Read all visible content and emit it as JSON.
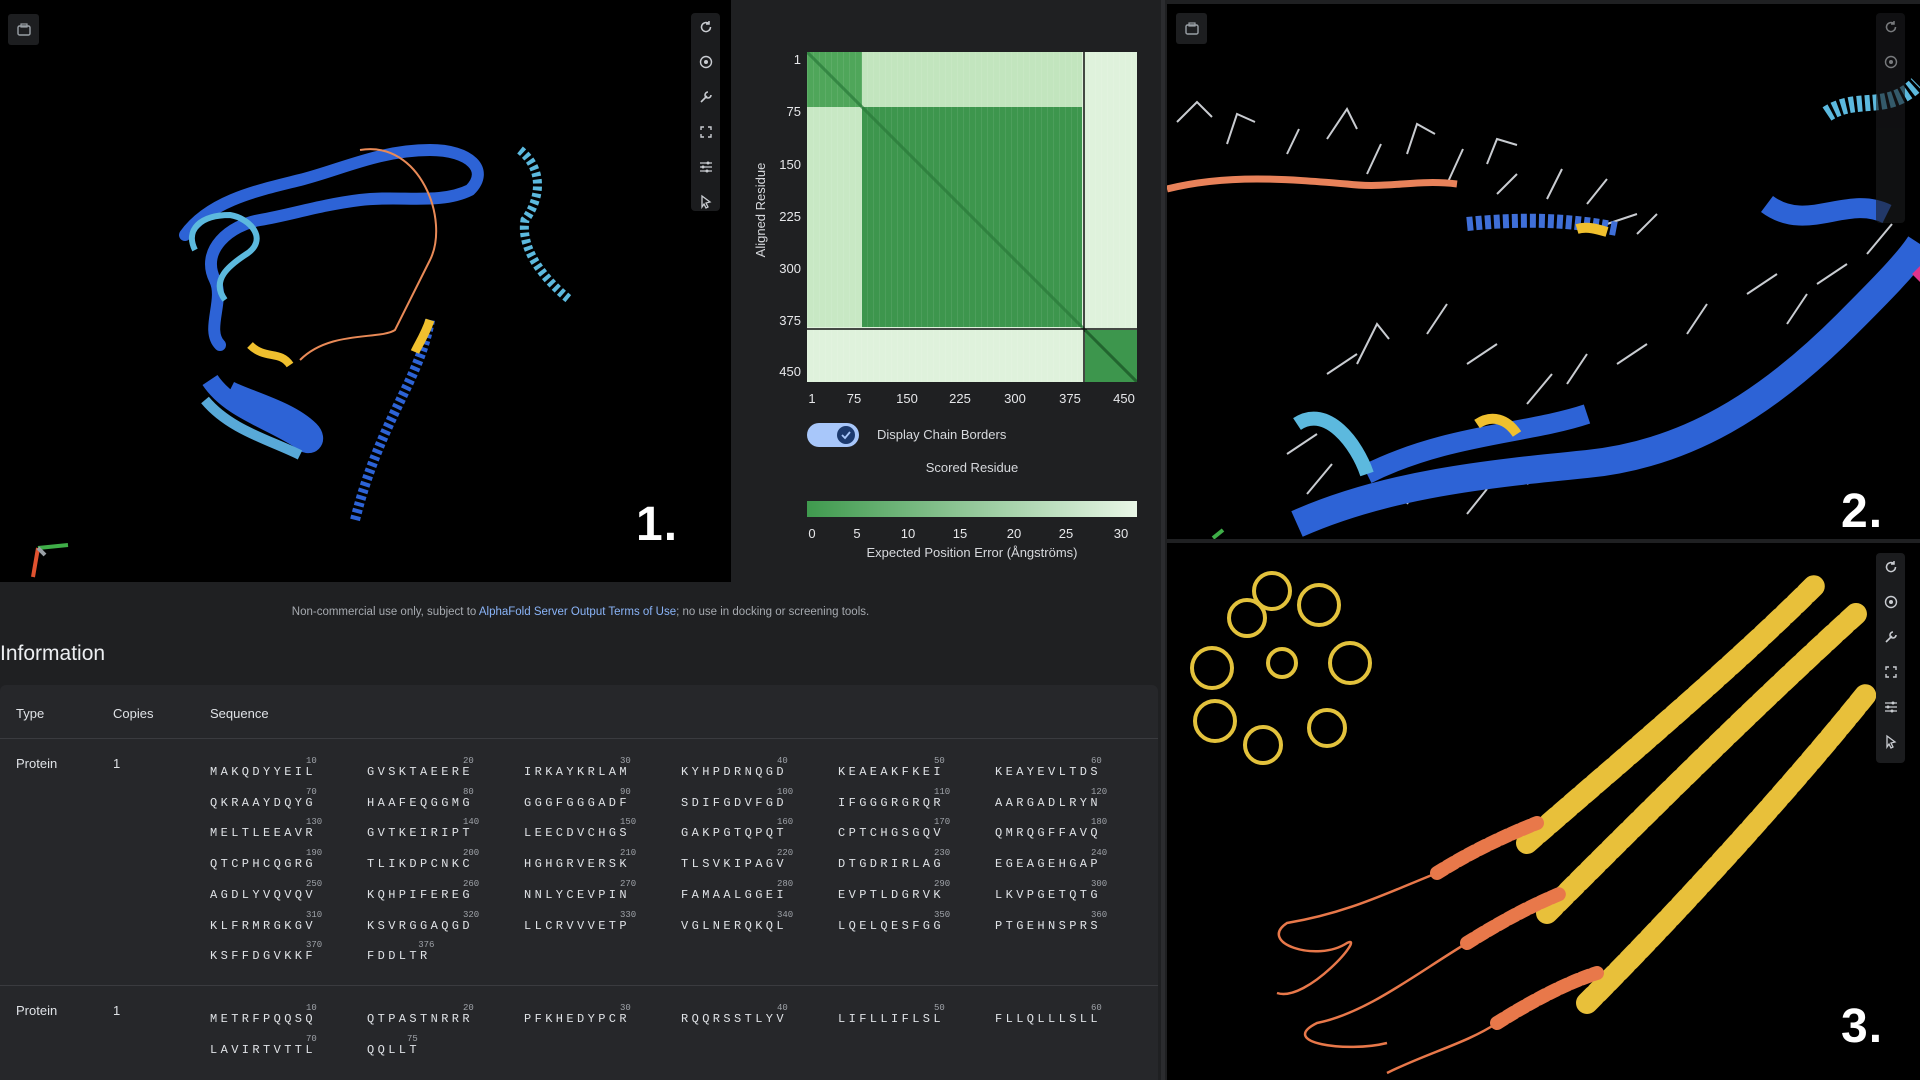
{
  "panel_labels": {
    "p1": "1.",
    "p2": "2.",
    "p3": "3."
  },
  "pae": {
    "y_axis_title": "Aligned Residue",
    "x_axis_title": "Scored Residue",
    "y_ticks": [
      "1",
      "75",
      "150",
      "225",
      "300",
      "375",
      "450"
    ],
    "x_ticks": [
      "1",
      "75",
      "150",
      "225",
      "300",
      "375",
      "450"
    ],
    "toggle_label": "Display Chain Borders",
    "toggle_on": true,
    "legend_ticks": [
      "0",
      "5",
      "10",
      "15",
      "20",
      "25",
      "30"
    ],
    "legend_title": "Expected Position Error (Ångströms)",
    "colors": {
      "dark": "#2e8b46",
      "light": "#e8f6e6"
    }
  },
  "footer": {
    "prefix": "Non-commercial use only, subject to ",
    "link": "AlphaFold Server Output Terms of Use",
    "suffix": "; no use in docking or screening tools."
  },
  "info": {
    "heading": "Information",
    "columns": {
      "type": "Type",
      "copies": "Copies",
      "sequence": "Sequence"
    },
    "rows": [
      {
        "type": "Protein",
        "copies": "1",
        "chunks": [
          {
            "idx": "10",
            "seq": "MAKQDYYEIL"
          },
          {
            "idx": "20",
            "seq": "GVSKTAEERE"
          },
          {
            "idx": "30",
            "seq": "IRKAYKRLAM"
          },
          {
            "idx": "40",
            "seq": "KYHPDRNQGD"
          },
          {
            "idx": "50",
            "seq": "KEAEAKFKEI"
          },
          {
            "idx": "60",
            "seq": "KEAYEVLTDS"
          },
          {
            "idx": "70",
            "seq": "QKRAAYDQYG"
          },
          {
            "idx": "80",
            "seq": "HAAFEQGGMG"
          },
          {
            "idx": "90",
            "seq": "GGGFGGGADF"
          },
          {
            "idx": "100",
            "seq": "SDIFGDVFGD"
          },
          {
            "idx": "110",
            "seq": "IFGGGRGRQR"
          },
          {
            "idx": "120",
            "seq": "AARGADLRYN"
          },
          {
            "idx": "130",
            "seq": "MELTLEEAVR"
          },
          {
            "idx": "140",
            "seq": "GVTKEIRIPT"
          },
          {
            "idx": "150",
            "seq": "LEECDVCHGS"
          },
          {
            "idx": "160",
            "seq": "GAKPGTQPQT"
          },
          {
            "idx": "170",
            "seq": "CPTCHGSGQV"
          },
          {
            "idx": "180",
            "seq": "QMRQGFFAVQ"
          },
          {
            "idx": "190",
            "seq": "QTCPHCQGRG"
          },
          {
            "idx": "200",
            "seq": "TLIKDPCNKC"
          },
          {
            "idx": "210",
            "seq": "HGHGRVERSK"
          },
          {
            "idx": "220",
            "seq": "TLSVKIPAGV"
          },
          {
            "idx": "230",
            "seq": "DTGDRIRLAG"
          },
          {
            "idx": "240",
            "seq": "EGEAGEHGAP"
          },
          {
            "idx": "250",
            "seq": "AGDLYVQVQV"
          },
          {
            "idx": "260",
            "seq": "KQHPIFEREG"
          },
          {
            "idx": "270",
            "seq": "NNLYCEVPIN"
          },
          {
            "idx": "280",
            "seq": "FAMAALGGEI"
          },
          {
            "idx": "290",
            "seq": "EVPTLDGRVK"
          },
          {
            "idx": "300",
            "seq": "LKVPGETQTG"
          },
          {
            "idx": "310",
            "seq": "KLFRMRGKGV"
          },
          {
            "idx": "320",
            "seq": "KSVRGGAQGD"
          },
          {
            "idx": "330",
            "seq": "LLCRVVVETP"
          },
          {
            "idx": "340",
            "seq": "VGLNERQKQL"
          },
          {
            "idx": "350",
            "seq": "LQELQESFGG"
          },
          {
            "idx": "360",
            "seq": "PTGEHNSPRS"
          },
          {
            "idx": "370",
            "seq": "KSFFDGVKKF"
          },
          {
            "idx": "376",
            "seq": "FDDLTR"
          }
        ]
      },
      {
        "type": "Protein",
        "copies": "1",
        "chunks": [
          {
            "idx": "10",
            "seq": "METRFPQQSQ"
          },
          {
            "idx": "20",
            "seq": "QTPASTNRRR"
          },
          {
            "idx": "30",
            "seq": "PFKHEDYPCR"
          },
          {
            "idx": "40",
            "seq": "RQQRSSTLYV"
          },
          {
            "idx": "50",
            "seq": "LIFLLIFLSL"
          },
          {
            "idx": "60",
            "seq": "FLLQLLLSLL"
          },
          {
            "idx": "70",
            "seq": "LAVIRTVTTL"
          },
          {
            "idx": "75",
            "seq": "QQLLT"
          }
        ]
      }
    ]
  },
  "icons": {
    "save": "save-icon",
    "reset": "reset-view-icon",
    "focus": "focus-icon",
    "measure": "wrench-icon",
    "expand": "fullscreen-icon",
    "settings": "sliders-icon",
    "select": "pointer-icon"
  }
}
